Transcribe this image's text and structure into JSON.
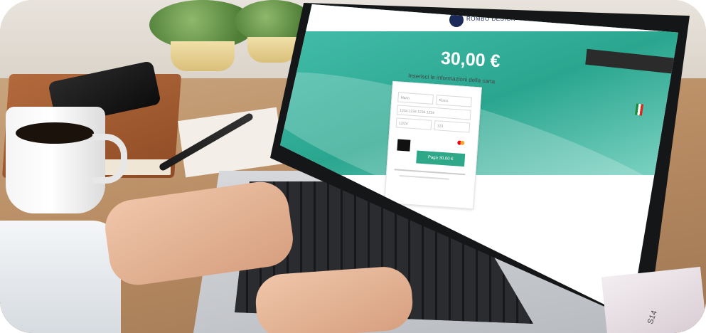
{
  "scene": {
    "description_labels": {
      "screen_logo": "ROMBO DESIGN",
      "amount": "30,00 €",
      "card_section_title": "Inserisci le informazioni della carta",
      "field_name": "Mario",
      "field_surname": "Rossi",
      "field_card": "1234 1234 1234 1234",
      "field_expiry": "12/24",
      "field_cvc": "123",
      "pay_button": "Paga 30,00 €",
      "box_label": "S14"
    }
  }
}
